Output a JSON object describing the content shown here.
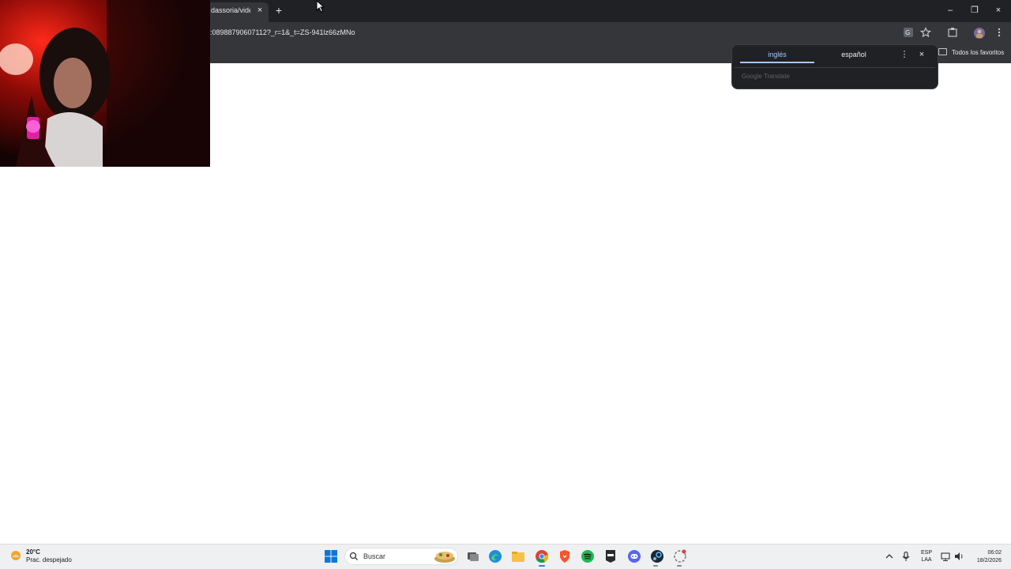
{
  "browser": {
    "tab": {
      "title": "dassoria/vide",
      "close_glyph": "×"
    },
    "new_tab_glyph": "+",
    "window_controls": {
      "minimize": "–",
      "maximize": "❐",
      "close": "×"
    },
    "url": ":08988790607112?_r=1&_t=ZS-941lz66zMNo",
    "bookmarks_bar": {
      "all_bookmarks_label": "Todos los favoritos"
    },
    "toolbar_icons": [
      "translate-icon",
      "star-icon",
      "extensions-icon",
      "profile-icon",
      "menu-icon"
    ]
  },
  "translate_popup": {
    "source_lang": "inglés",
    "target_lang": "español",
    "menu_glyph": "⋮",
    "close_glyph": "×",
    "footer": "Google Translate"
  },
  "taskbar": {
    "weather": {
      "temp": "20°C",
      "desc": "Prac. despejado"
    },
    "search_label": "Buscar",
    "tray": {
      "lang_line1": "ESP",
      "lang_line2": "LAA"
    },
    "clock": {
      "time": "06:02",
      "date": "18/2/2026"
    },
    "pinned_apps": [
      "windows-start",
      "widgets",
      "task-view",
      "edge",
      "file-explorer",
      "chrome",
      "brave",
      "spotify",
      "epic-games",
      "discord",
      "steam",
      "other-app"
    ]
  },
  "colors": {
    "chrome_dark": "#202124",
    "chrome_toolbar": "#35363a",
    "accent_blue": "#a8c7fa",
    "taskbar_bg": "#eff0f2"
  }
}
